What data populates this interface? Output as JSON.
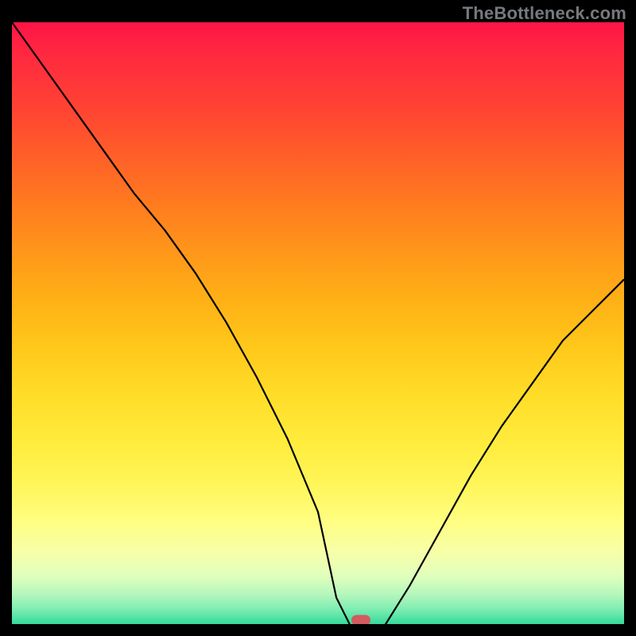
{
  "watermark": "TheBottleneck.com",
  "colors": {
    "page_bg": "#000000",
    "curve_stroke": "#000000",
    "marker_fill": "#d35a5f",
    "watermark_color": "#777a7d",
    "gradient_top": "#ff1447",
    "gradient_bottom": "#34db9a"
  },
  "chart_data": {
    "type": "line",
    "title": "",
    "xlabel": "",
    "ylabel": "",
    "xlim": [
      0,
      100
    ],
    "ylim": [
      0,
      100
    ],
    "grid": false,
    "x": [
      0,
      5,
      10,
      15,
      20,
      25,
      30,
      35,
      40,
      45,
      50,
      53,
      56,
      60,
      65,
      70,
      75,
      80,
      85,
      90,
      95,
      100
    ],
    "y": [
      100,
      93,
      86,
      79,
      72,
      66,
      59,
      51,
      42,
      32,
      20,
      6,
      0,
      0,
      8,
      17,
      26,
      34,
      41,
      48,
      53,
      58
    ],
    "annotations": [
      {
        "kind": "marker-pill",
        "x": 57,
        "y": 0
      }
    ],
    "background": "vertical-gradient-red-to-green"
  }
}
